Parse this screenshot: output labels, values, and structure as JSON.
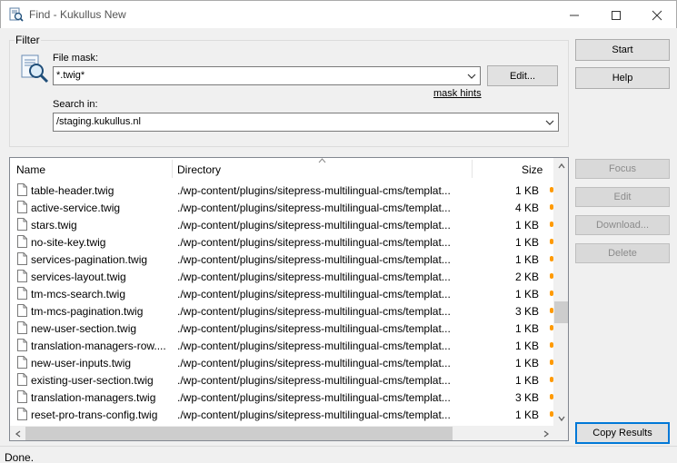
{
  "window": {
    "title": "Find - Kukullus New",
    "icons": [
      "find-app-icon",
      "minimize-icon",
      "maximize-icon",
      "close-icon"
    ]
  },
  "filter": {
    "legend": "Filter",
    "file_mask_label": "File mask:",
    "file_mask_value": "*.twig*",
    "edit_button": "Edit...",
    "mask_hints": "mask hints",
    "search_in_label": "Search in:",
    "search_in_value": "/staging.kukullus.nl"
  },
  "buttons": {
    "start": "Start",
    "help": "Help",
    "focus": "Focus",
    "edit": "Edit",
    "download": "Download...",
    "delete": "Delete",
    "copy_results": "Copy Results"
  },
  "results": {
    "columns": [
      "Name",
      "Directory",
      "Size"
    ],
    "rows": [
      {
        "name": "table-header.twig",
        "dir": "./wp-content/plugins/sitepress-multilingual-cms/templat...",
        "size": "1 KB"
      },
      {
        "name": "active-service.twig",
        "dir": "./wp-content/plugins/sitepress-multilingual-cms/templat...",
        "size": "4 KB"
      },
      {
        "name": "stars.twig",
        "dir": "./wp-content/plugins/sitepress-multilingual-cms/templat...",
        "size": "1 KB"
      },
      {
        "name": "no-site-key.twig",
        "dir": "./wp-content/plugins/sitepress-multilingual-cms/templat...",
        "size": "1 KB"
      },
      {
        "name": "services-pagination.twig",
        "dir": "./wp-content/plugins/sitepress-multilingual-cms/templat...",
        "size": "1 KB"
      },
      {
        "name": "services-layout.twig",
        "dir": "./wp-content/plugins/sitepress-multilingual-cms/templat...",
        "size": "2 KB"
      },
      {
        "name": "tm-mcs-search.twig",
        "dir": "./wp-content/plugins/sitepress-multilingual-cms/templat...",
        "size": "1 KB"
      },
      {
        "name": "tm-mcs-pagination.twig",
        "dir": "./wp-content/plugins/sitepress-multilingual-cms/templat...",
        "size": "3 KB"
      },
      {
        "name": "new-user-section.twig",
        "dir": "./wp-content/plugins/sitepress-multilingual-cms/templat...",
        "size": "1 KB"
      },
      {
        "name": "translation-managers-row....",
        "dir": "./wp-content/plugins/sitepress-multilingual-cms/templat...",
        "size": "1 KB"
      },
      {
        "name": "new-user-inputs.twig",
        "dir": "./wp-content/plugins/sitepress-multilingual-cms/templat...",
        "size": "1 KB"
      },
      {
        "name": "existing-user-section.twig",
        "dir": "./wp-content/plugins/sitepress-multilingual-cms/templat...",
        "size": "1 KB"
      },
      {
        "name": "translation-managers.twig",
        "dir": "./wp-content/plugins/sitepress-multilingual-cms/templat...",
        "size": "3 KB"
      },
      {
        "name": "reset-pro-trans-config.twig",
        "dir": "./wp-content/plugins/sitepress-multilingual-cms/templat...",
        "size": "1 KB"
      }
    ]
  },
  "status": {
    "text": "Done."
  },
  "colors": {
    "accent": "#0078d7",
    "marker": "#ff9a00"
  }
}
